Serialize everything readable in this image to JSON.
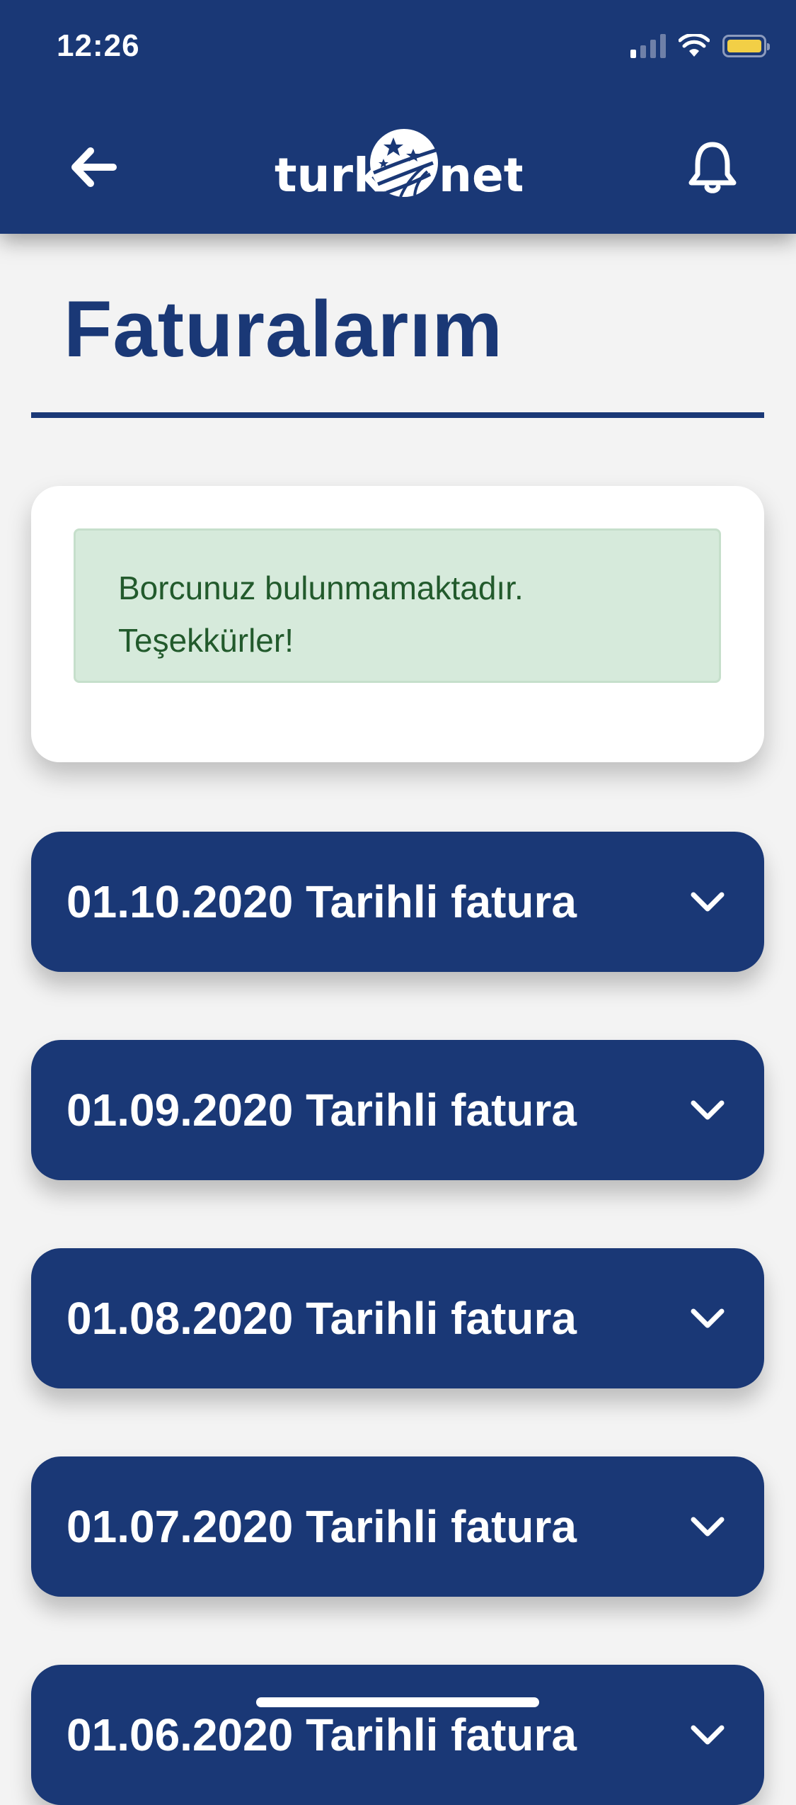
{
  "status_bar": {
    "time": "12:26"
  },
  "header": {
    "back_icon": "arrow-left-icon",
    "logo_text_left": "turk",
    "logo_text_right": "net",
    "bell_icon": "bell-icon",
    "colors": {
      "primary": "#1a3876",
      "battery": "#f2cf46"
    }
  },
  "page": {
    "title": "Faturalarım"
  },
  "notice": {
    "line1": "Borcunuz bulunmamaktadır.",
    "line2": "Teşekkürler!",
    "colors": {
      "background": "#d6eadb",
      "text": "#225a2c"
    }
  },
  "invoices": [
    {
      "label": "01.10.2020 Tarihli fatura"
    },
    {
      "label": "01.09.2020 Tarihli fatura"
    },
    {
      "label": "01.08.2020 Tarihli fatura"
    },
    {
      "label": "01.07.2020 Tarihli fatura"
    },
    {
      "label": "01.06.2020 Tarihli fatura"
    }
  ]
}
